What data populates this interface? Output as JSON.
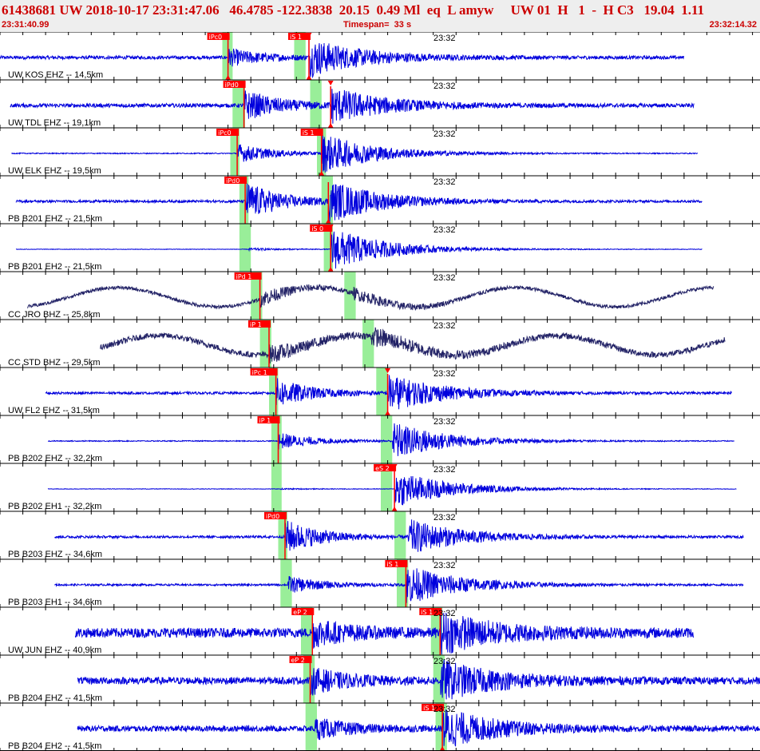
{
  "header": {
    "title": "61438681 UW 2018-10-17 23:31:47.06   46.4785 -122.3838  20.15  0.49 Ml  eq  L amyw     UW 01  H   1  -  H C3   19.04  1.11",
    "start_time": "23:31:40.99",
    "timespan": "Timespan=  33 s",
    "end_time": "23:32:14.32"
  },
  "colors": {
    "trace": "#0000dd",
    "trace_broadband": "#222266",
    "pick": "#ff0000",
    "window": "#99ee99",
    "grid": "#000000",
    "header_text": "#cc0000"
  },
  "chart_data": {
    "type": "line",
    "x_range_s": [
      0,
      33.33
    ],
    "time_label": "23:32",
    "time_label_s": 19.01,
    "traces": [
      {
        "label": "UW KOS EHZ -- 14,5km",
        "start": 0.0,
        "end": 30.0,
        "noise": 0.07,
        "lp": 0,
        "p": 10.0,
        "s": 13.55,
        "p_amp": 0.35,
        "s_amp": 0.75,
        "picks": [
          {
            "label": "iPc0",
            "t": 10.0,
            "tri_bottom": true
          },
          {
            "label": "iS 1",
            "t": 13.55,
            "tri_top": true,
            "tri_bottom": true
          }
        ],
        "windows": [
          [
            9.75,
            10.2
          ],
          [
            12.9,
            13.4
          ]
        ]
      },
      {
        "label": "UW TDL EHZ -- 19,1km",
        "start": 0.45,
        "end": 30.45,
        "noise": 0.08,
        "lp": 0,
        "p": 10.7,
        "s": 14.5,
        "p_amp": 0.6,
        "s_amp": 0.7,
        "picks": [
          {
            "label": "iPd0",
            "t": 10.7
          },
          {
            "label": "",
            "t": 14.5,
            "tri_top": true,
            "tri_bottom": true
          }
        ],
        "windows": [
          [
            10.2,
            10.75
          ],
          [
            13.6,
            14.1
          ]
        ]
      },
      {
        "label": "UW ELK EHZ -- 19,5km",
        "start": 0.5,
        "end": 30.6,
        "noise": 0.02,
        "lp": 0,
        "p": 10.4,
        "s": 14.1,
        "p_amp": 0.4,
        "s_amp": 0.8,
        "picks": [
          {
            "label": "iPc0",
            "t": 10.4
          },
          {
            "label": "iS 1",
            "t": 14.1,
            "tri_bottom": true
          }
        ],
        "windows": [
          [
            10.1,
            10.5
          ],
          [
            13.9,
            14.3
          ]
        ]
      },
      {
        "label": "PB B201 EHZ -- 21,5km",
        "start": 0.7,
        "end": 30.8,
        "noise": 0.05,
        "lp": 0,
        "p": 10.75,
        "s": 14.4,
        "p_amp": 0.8,
        "s_amp": 0.8,
        "picks": [
          {
            "label": "iPd0",
            "t": 10.75
          },
          {
            "label": "",
            "t": 14.4,
            "tri_bottom": true
          }
        ],
        "windows": [
          [
            10.5,
            10.9
          ],
          [
            14.1,
            14.6
          ]
        ]
      },
      {
        "label": "PB B201 EH2 -- 21,5km",
        "start": 0.7,
        "end": 30.8,
        "noise": 0.01,
        "lp": 0,
        "p": 10.9,
        "s": 14.5,
        "p_amp": 0.05,
        "s_amp": 0.9,
        "picks": [
          {
            "label": "iS 0",
            "t": 14.5,
            "tri_top": true,
            "tri_bottom": true
          }
        ],
        "windows": [
          [
            10.5,
            11.0
          ],
          [
            14.2,
            14.6
          ]
        ]
      },
      {
        "label": "CC JRO BHZ -- 25,8km",
        "start": 1.2,
        "end": 31.3,
        "noise": 0.07,
        "lp": 0.4,
        "p": 11.4,
        "s": 15.5,
        "p_amp": 0.3,
        "s_amp": 0.2,
        "picks": [
          {
            "label": "iPd 1",
            "t": 11.4
          }
        ],
        "windows": [
          [
            11.0,
            11.5
          ],
          [
            15.1,
            15.6
          ]
        ]
      },
      {
        "label": "CC STD BHZ -- 29,5km",
        "start": 4.4,
        "end": 31.8,
        "noise": 0.12,
        "lp": 0.4,
        "p": 11.8,
        "s": 16.3,
        "p_amp": 0.3,
        "s_amp": 0.3,
        "picks": [
          {
            "label": "iP 1",
            "t": 11.8
          }
        ],
        "windows": [
          [
            11.4,
            11.9
          ],
          [
            15.9,
            16.4
          ]
        ]
      },
      {
        "label": "UW FL2 EHZ -- 31,5km",
        "start": 2.0,
        "end": 32.1,
        "noise": 0.05,
        "lp": 0,
        "p": 12.1,
        "s": 17.0,
        "p_amp": 0.6,
        "s_amp": 0.75,
        "picks": [
          {
            "label": "iPc 1",
            "t": 12.1
          },
          {
            "label": "",
            "t": 17.0,
            "tri_top": true,
            "tri_bottom": true
          }
        ],
        "windows": [
          [
            11.8,
            12.2
          ],
          [
            16.5,
            17.0
          ]
        ]
      },
      {
        "label": "PB B202 EHZ -- 32,2km",
        "start": 2.1,
        "end": 32.2,
        "noise": 0.02,
        "lp": 0,
        "p": 12.2,
        "s": 17.2,
        "p_amp": 0.35,
        "s_amp": 0.8,
        "picks": [
          {
            "label": "iP 1",
            "t": 12.2
          }
        ],
        "windows": [
          [
            11.9,
            12.35
          ],
          [
            16.7,
            17.2
          ]
        ]
      },
      {
        "label": "PB B202 EH1 -- 32,2km",
        "start": 2.1,
        "end": 32.3,
        "noise": 0.01,
        "lp": 0,
        "p": 12.3,
        "s": 17.3,
        "p_amp": 0.02,
        "s_amp": 0.8,
        "picks": [
          {
            "label": "eS 2",
            "t": 17.3,
            "tri_top": true,
            "tri_bottom": true
          }
        ],
        "windows": [
          [
            11.9,
            12.35
          ],
          [
            16.7,
            17.2
          ]
        ]
      },
      {
        "label": "PB B203 EHZ -- 34,6km",
        "start": 2.4,
        "end": 32.6,
        "noise": 0.05,
        "lp": 0,
        "p": 12.5,
        "s": 17.9,
        "p_amp": 0.7,
        "s_amp": 0.7,
        "picks": [
          {
            "label": "iPd0",
            "t": 12.5
          }
        ],
        "windows": [
          [
            12.2,
            12.6
          ],
          [
            17.3,
            17.8
          ]
        ]
      },
      {
        "label": "PB B203 EH1 -- 34,6km",
        "start": 2.4,
        "end": 32.6,
        "noise": 0.04,
        "lp": 0,
        "p": 12.6,
        "s": 17.8,
        "p_amp": 0.35,
        "s_amp": 0.8,
        "picks": [
          {
            "label": "iS 1",
            "t": 17.8
          }
        ],
        "windows": [
          [
            12.3,
            12.8
          ],
          [
            17.4,
            17.9
          ]
        ]
      },
      {
        "label": "UW JUN EHZ -- 40,9km",
        "start": 3.3,
        "end": 30.4,
        "noise": 0.2,
        "lp": 0,
        "p": 13.7,
        "s": 19.3,
        "p_amp": 0.5,
        "s_amp": 0.8,
        "picks": [
          {
            "label": "eP 2",
            "t": 13.7
          },
          {
            "label": "iS 1",
            "t": 19.3
          }
        ],
        "windows": [
          [
            13.2,
            13.7
          ],
          [
            18.9,
            19.4
          ]
        ]
      },
      {
        "label": "PB B204 EHZ -- 41,5km",
        "start": 3.4,
        "end": 33.33,
        "noise": 0.15,
        "lp": 0,
        "p": 13.6,
        "s": 19.3,
        "p_amp": 0.5,
        "s_amp": 0.8,
        "picks": [
          {
            "label": "eP 2",
            "t": 13.6
          }
        ],
        "windows": [
          [
            13.3,
            13.8
          ],
          [
            19.0,
            19.5
          ]
        ]
      },
      {
        "label": "PB B204 EH2 -- 41,5km",
        "start": 3.4,
        "end": 33.33,
        "noise": 0.12,
        "lp": 0,
        "p": 13.8,
        "s": 19.4,
        "p_amp": 0.4,
        "s_amp": 0.8,
        "picks": [
          {
            "label": "iS 1",
            "t": 19.4,
            "tri_bottom": true
          }
        ],
        "windows": [
          [
            13.4,
            13.9
          ],
          [
            19.1,
            19.6
          ]
        ]
      }
    ]
  }
}
